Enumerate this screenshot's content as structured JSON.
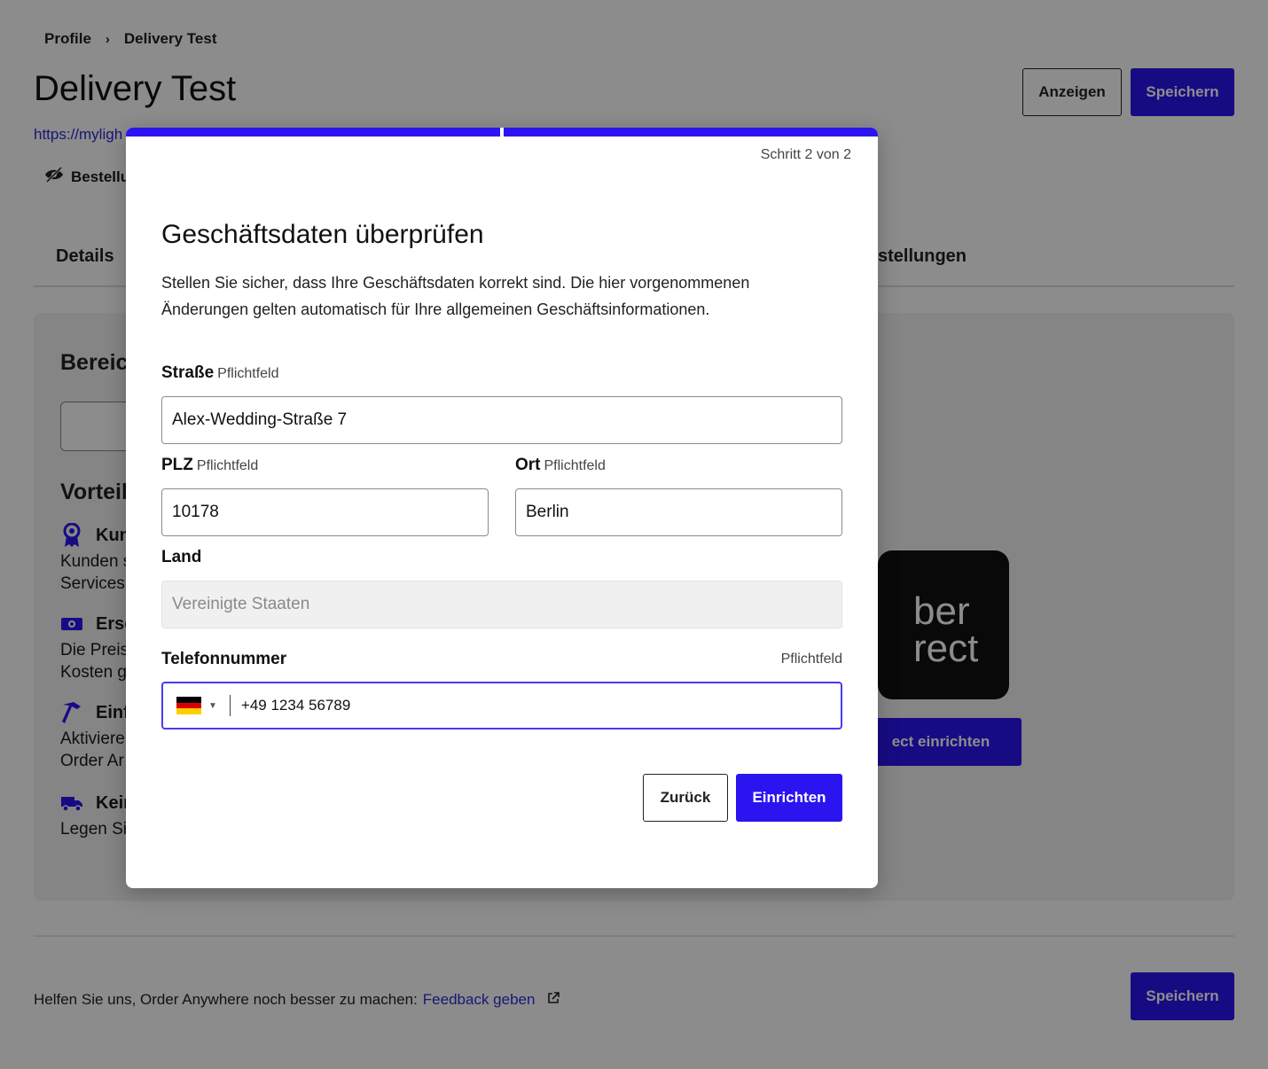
{
  "breadcrumb": {
    "parent": "Profile",
    "separator": "›",
    "current": "Delivery Test"
  },
  "page": {
    "title": "Delivery Test",
    "url_fragment": "https://myligh",
    "visibility_label": "Bestellu"
  },
  "header_actions": {
    "view_label": "Anzeigen",
    "save_label": "Speichern"
  },
  "tabs": [
    {
      "label": "Details"
    },
    {
      "label": "stellungen"
    }
  ],
  "card": {
    "section_heading": "Bereich",
    "benefits_heading": "Vorteil",
    "benefits": [
      {
        "icon": "award-icon",
        "title": "Kun",
        "text_line1": "Kunden s",
        "text_line2": "Services"
      },
      {
        "icon": "money-icon",
        "title": "Ersc",
        "text_line1": "Die Preis",
        "text_line2": "Kosten g"
      },
      {
        "icon": "hammer-icon",
        "title": "Einf",
        "text_line1": "Aktiviere",
        "text_line2": "Order Ar"
      },
      {
        "icon": "truck-icon",
        "title": "Kein",
        "text_line1": "Legen Sie",
        "text_line2": ""
      }
    ],
    "logo_line1": "ber",
    "logo_line2": "rect",
    "setup_button_label": "ect einrichten"
  },
  "footer": {
    "feedback_prefix": "Helfen Sie uns, Order Anywhere noch besser zu machen:",
    "feedback_link": "Feedback geben",
    "save_label": "Speichern"
  },
  "modal": {
    "step_text": "Schritt 2 von 2",
    "title": "Geschäftsdaten überprüfen",
    "description": "Stellen Sie sicher, dass Ihre Geschäftsdaten korrekt sind. Die hier vorgenommenen Änderungen gelten automatisch für Ihre allgemeinen Geschäftsinformationen.",
    "street": {
      "label": "Straße",
      "required": "Pflichtfeld",
      "value": "Alex-Wedding-Straße 7"
    },
    "zip": {
      "label": "PLZ",
      "required": "Pflichtfeld",
      "value": "10178"
    },
    "city": {
      "label": "Ort",
      "required": "Pflichtfeld",
      "value": "Berlin"
    },
    "country": {
      "label": "Land",
      "value": "Vereinigte Staaten"
    },
    "phone": {
      "label": "Telefonnummer",
      "required": "Pflichtfeld",
      "value": "+49 1234 56789",
      "country_flag": "flag-germany-icon"
    },
    "back_label": "Zurück",
    "submit_label": "Einrichten"
  },
  "colors": {
    "primary": "#2b14f0",
    "link": "#2a2bd6",
    "focus": "#4a3bf0"
  }
}
